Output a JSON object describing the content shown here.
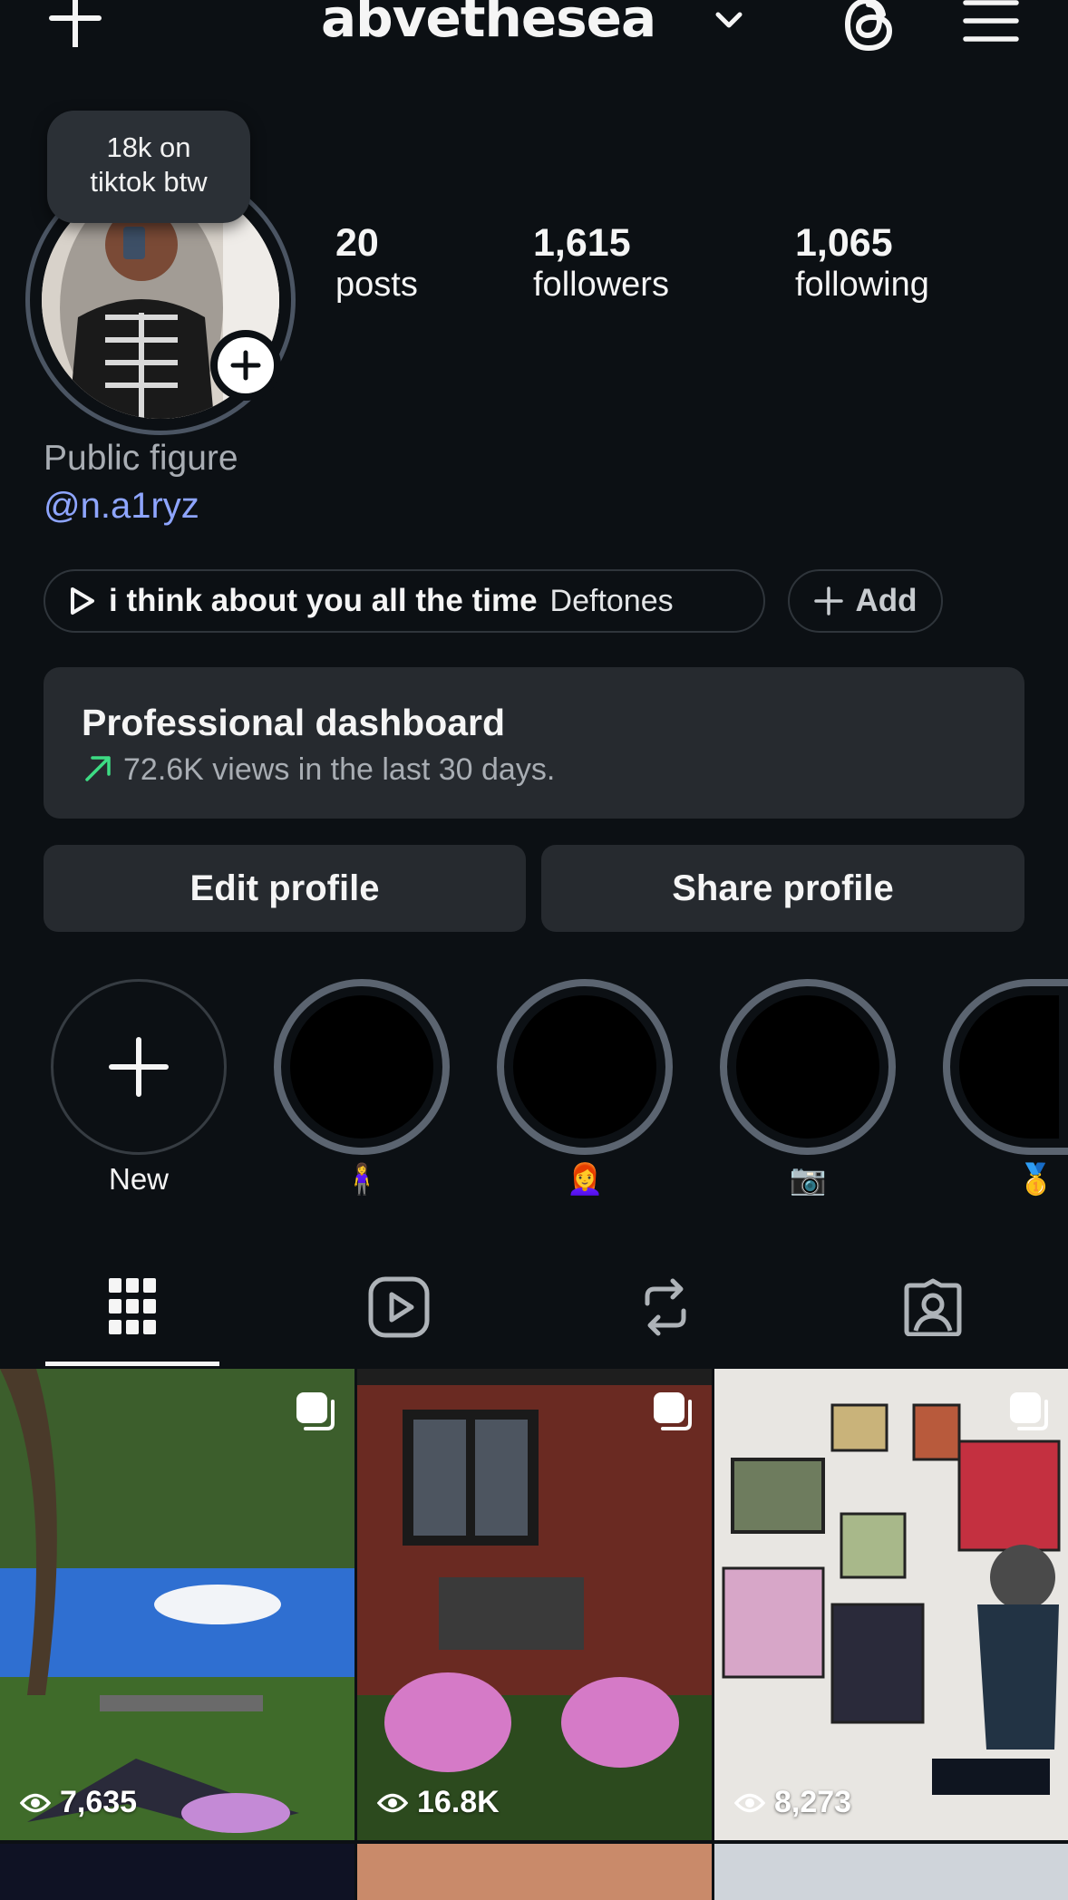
{
  "header": {
    "username": "abvethesea"
  },
  "profile": {
    "note": "18k on\ntiktok btw",
    "stats": [
      {
        "value": "20",
        "label": "posts"
      },
      {
        "value": "1,615",
        "label": "followers"
      },
      {
        "value": "1,065",
        "label": "following"
      }
    ],
    "category": "Public figure",
    "handle": "@n.a1ryz"
  },
  "music": {
    "song": "i think about you all the time",
    "artist": "Deftones",
    "add_label": "Add"
  },
  "dashboard": {
    "title": "Professional dashboard",
    "subtitle": "72.6K views in the last 30 days.",
    "accent": "#3ddc84"
  },
  "buttons": {
    "edit": "Edit profile",
    "share": "Share profile"
  },
  "highlights": [
    {
      "label": "New"
    },
    {
      "label": "🧍‍♀️"
    },
    {
      "label": "👩‍🦰"
    },
    {
      "label": "📷"
    },
    {
      "label": "🥇"
    }
  ],
  "tabs": [
    "grid-icon",
    "reels-icon",
    "reposts-icon",
    "tagged-icon"
  ],
  "posts": [
    {
      "views": "7,635"
    },
    {
      "views": "16.8K"
    },
    {
      "views": "8,273"
    }
  ],
  "colors": {
    "background": "#0c1014",
    "card": "#262a2f",
    "link": "#8ea5ff"
  }
}
